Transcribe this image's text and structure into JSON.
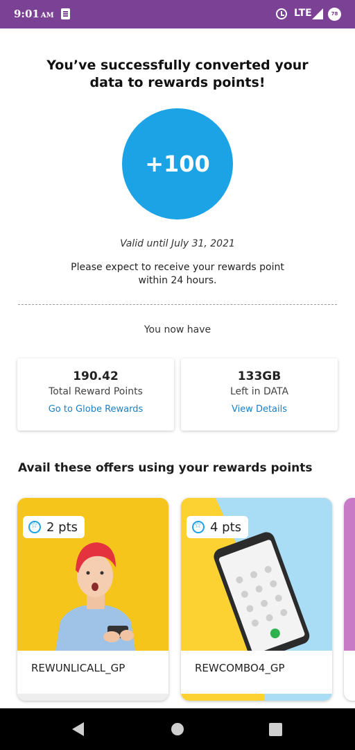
{
  "status_bar": {
    "time": "9:01",
    "ampm": "AM",
    "network": "LTE",
    "battery": "78"
  },
  "result": {
    "headline": "You’ve successfully converted your data to rewards points!",
    "points_awarded": "+100",
    "valid_until": "Valid until July 31, 2021",
    "expect_note": "Please expect to receive your rewards point within 24 hours.",
    "now_have": "You now have"
  },
  "summary": {
    "rewards": {
      "value": "190.42",
      "label": "Total Reward Points",
      "link": "Go to Globe Rewards"
    },
    "data": {
      "value": "133GB",
      "label": "Left in DATA",
      "link": "View Details"
    }
  },
  "offers": {
    "title": "Avail these offers using your rewards points",
    "items": [
      {
        "points": "2 pts",
        "name": "REWUNLICALL_GP"
      },
      {
        "points": "4 pts",
        "name": "REWCOMBO4_GP"
      }
    ]
  },
  "colors": {
    "status_bar": "#7b4195",
    "accent": "#1ba3e6",
    "link": "#1a7fc4"
  },
  "icons": {
    "note": "note-icon",
    "alarm": "alarm-icon",
    "signal": "signal-icon",
    "battery": "battery-icon",
    "star": "star-icon",
    "back": "back-icon",
    "home": "home-icon",
    "recents": "recents-icon"
  }
}
